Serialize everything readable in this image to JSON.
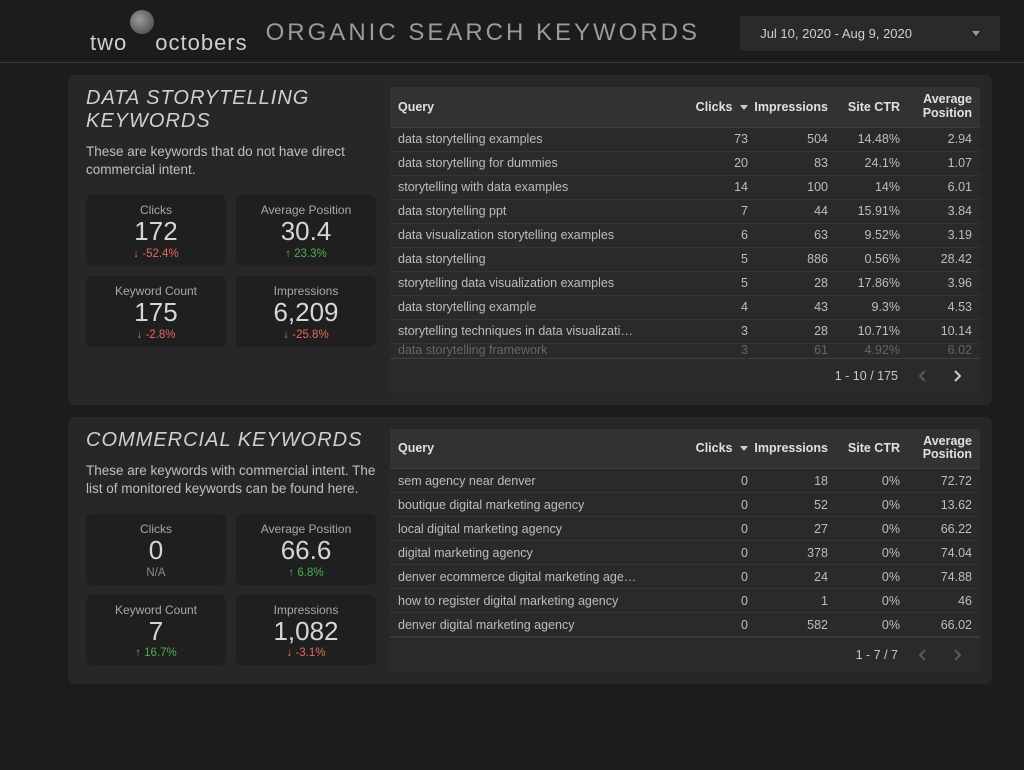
{
  "header": {
    "brand_left": "two",
    "brand_right": "octobers",
    "title": "ORGANIC SEARCH KEYWORDS",
    "date_range": "Jul 10, 2020 - Aug 9, 2020"
  },
  "sections": [
    {
      "title": "DATA STORYTELLING KEYWORDS",
      "description": "These are keywords that do not have direct commercial intent.",
      "metrics": [
        {
          "label": "Clicks",
          "value": "172",
          "delta": "-52.4%",
          "dir": "down"
        },
        {
          "label": "Average Position",
          "value": "30.4",
          "delta": "23.3%",
          "dir": "up"
        },
        {
          "label": "Keyword Count",
          "value": "175",
          "delta": "-2.8%",
          "dir": "down"
        },
        {
          "label": "Impressions",
          "value": "6,209",
          "delta": "-25.8%",
          "dir": "down"
        }
      ],
      "table": {
        "columns": {
          "query": "Query",
          "clicks": "Clicks",
          "impressions": "Impressions",
          "ctr": "Site CTR",
          "avg": "Average Position"
        },
        "rows": [
          {
            "query": "data storytelling examples",
            "clicks": "73",
            "impr": "504",
            "ctr": "14.48%",
            "avg": "2.94"
          },
          {
            "query": "data storytelling for dummies",
            "clicks": "20",
            "impr": "83",
            "ctr": "24.1%",
            "avg": "1.07"
          },
          {
            "query": "storytelling with data examples",
            "clicks": "14",
            "impr": "100",
            "ctr": "14%",
            "avg": "6.01"
          },
          {
            "query": "data storytelling ppt",
            "clicks": "7",
            "impr": "44",
            "ctr": "15.91%",
            "avg": "3.84"
          },
          {
            "query": "data visualization storytelling examples",
            "clicks": "6",
            "impr": "63",
            "ctr": "9.52%",
            "avg": "3.19"
          },
          {
            "query": "data storytelling",
            "clicks": "5",
            "impr": "886",
            "ctr": "0.56%",
            "avg": "28.42"
          },
          {
            "query": "storytelling data visualization examples",
            "clicks": "5",
            "impr": "28",
            "ctr": "17.86%",
            "avg": "3.96"
          },
          {
            "query": "data storytelling example",
            "clicks": "4",
            "impr": "43",
            "ctr": "9.3%",
            "avg": "4.53"
          },
          {
            "query": "storytelling techniques in data visualizati…",
            "clicks": "3",
            "impr": "28",
            "ctr": "10.71%",
            "avg": "10.14"
          },
          {
            "query": "data storytelling framework",
            "clicks": "3",
            "impr": "61",
            "ctr": "4.92%",
            "avg": "6.02"
          }
        ],
        "cutoff_last": true,
        "pagination": "1 - 10 / 175",
        "prev_disabled": true,
        "next_disabled": false
      }
    },
    {
      "title": "COMMERCIAL KEYWORDS",
      "description": "These are keywords with commercial intent. The list of monitored keywords can be found here.",
      "metrics": [
        {
          "label": "Clicks",
          "value": "0",
          "delta": "N/A",
          "dir": "na"
        },
        {
          "label": "Average Position",
          "value": "66.6",
          "delta": "6.8%",
          "dir": "up"
        },
        {
          "label": "Keyword Count",
          "value": "7",
          "delta": "16.7%",
          "dir": "up"
        },
        {
          "label": "Impressions",
          "value": "1,082",
          "delta": "-3.1%",
          "dir": "down"
        }
      ],
      "table": {
        "columns": {
          "query": "Query",
          "clicks": "Clicks",
          "impressions": "Impressions",
          "ctr": "Site CTR",
          "avg": "Average Position"
        },
        "rows": [
          {
            "query": "sem agency near denver",
            "clicks": "0",
            "impr": "18",
            "ctr": "0%",
            "avg": "72.72"
          },
          {
            "query": "boutique digital marketing agency",
            "clicks": "0",
            "impr": "52",
            "ctr": "0%",
            "avg": "13.62"
          },
          {
            "query": "local digital marketing agency",
            "clicks": "0",
            "impr": "27",
            "ctr": "0%",
            "avg": "66.22"
          },
          {
            "query": "digital marketing agency",
            "clicks": "0",
            "impr": "378",
            "ctr": "0%",
            "avg": "74.04"
          },
          {
            "query": "denver ecommerce digital marketing age…",
            "clicks": "0",
            "impr": "24",
            "ctr": "0%",
            "avg": "74.88"
          },
          {
            "query": "how to register digital marketing agency",
            "clicks": "0",
            "impr": "1",
            "ctr": "0%",
            "avg": "46"
          },
          {
            "query": "denver digital marketing agency",
            "clicks": "0",
            "impr": "582",
            "ctr": "0%",
            "avg": "66.02"
          }
        ],
        "cutoff_last": false,
        "pagination": "1 - 7 / 7",
        "prev_disabled": true,
        "next_disabled": true
      }
    }
  ]
}
